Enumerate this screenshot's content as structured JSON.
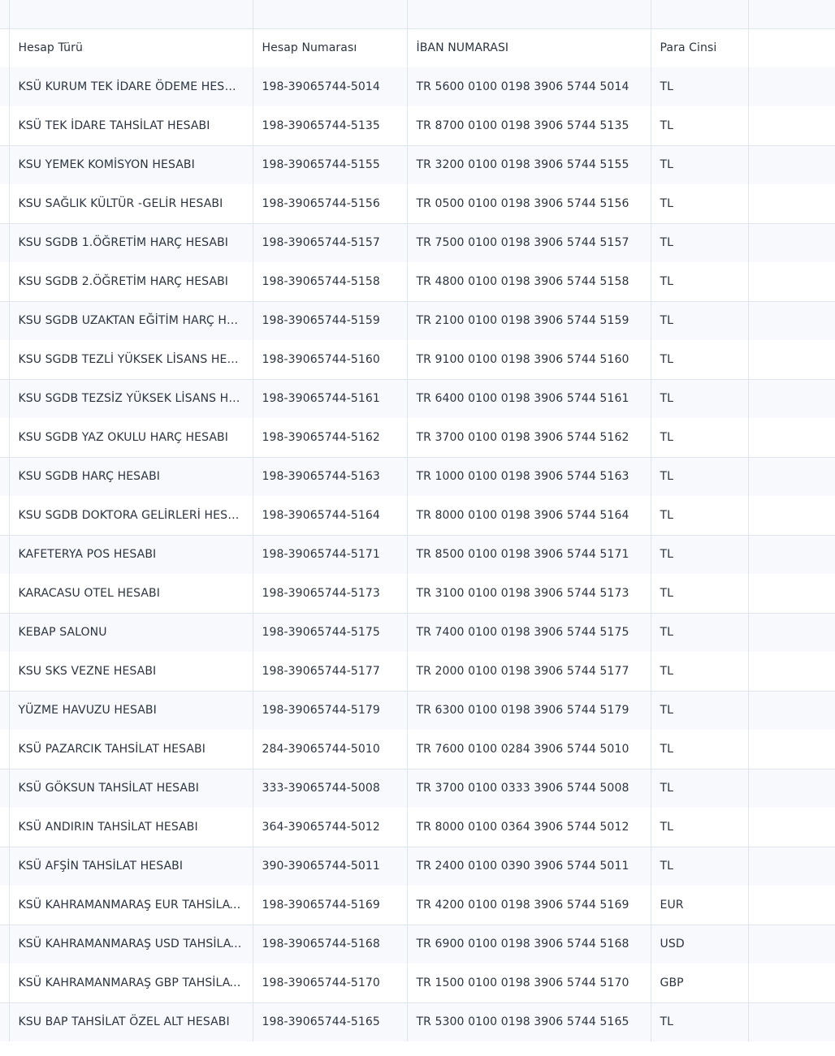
{
  "table": {
    "headers": {
      "type": "Hesap Türü",
      "number": "Hesap Numarası",
      "iban": "İBAN NUMARASI",
      "currency": "Para Cinsi"
    },
    "rows": [
      {
        "type": "KSÜ KURUM TEK İDARE ÖDEME HESABI",
        "number": "198-39065744-5014",
        "iban": "TR 5600 0100 0198 3906 5744 5014",
        "currency": "TL"
      },
      {
        "type": "KSÜ TEK İDARE TAHSİLAT HESABI",
        "number": "198-39065744-5135",
        "iban": "TR 8700 0100 0198 3906 5744 5135",
        "currency": "TL"
      },
      {
        "type": "KSU YEMEK KOMİSYON HESABI",
        "number": "198-39065744-5155",
        "iban": "TR 3200 0100 0198 3906 5744 5155",
        "currency": "TL"
      },
      {
        "type": "KSU SAĞLIK KÜLTÜR -GELİR HESABI",
        "number": "198-39065744-5156",
        "iban": "TR 0500 0100 0198 3906 5744 5156",
        "currency": "TL"
      },
      {
        "type": "KSU SGDB 1.ÖĞRETİM HARÇ HESABI",
        "number": "198-39065744-5157",
        "iban": "TR 7500 0100 0198 3906 5744 5157",
        "currency": "TL"
      },
      {
        "type": "KSU SGDB 2.ÖĞRETİM HARÇ HESABI",
        "number": "198-39065744-5158",
        "iban": "TR 4800 0100 0198 3906 5744 5158",
        "currency": "TL"
      },
      {
        "type": "KSU SGDB UZAKTAN EĞİTİM HARÇ HESABI",
        "number": "198-39065744-5159",
        "iban": "TR 2100 0100 0198 3906 5744 5159",
        "currency": "TL"
      },
      {
        "type": "KSU SGDB TEZLİ YÜKSEK LİSANS HESABI",
        "number": "198-39065744-5160",
        "iban": "TR 9100 0100 0198 3906 5744 5160",
        "currency": "TL"
      },
      {
        "type": "KSU SGDB TEZSİZ YÜKSEK LİSANS HESABI",
        "number": "198-39065744-5161",
        "iban": "TR 6400 0100 0198 3906 5744 5161",
        "currency": "TL"
      },
      {
        "type": "KSU SGDB YAZ OKULU HARÇ HESABI",
        "number": "198-39065744-5162",
        "iban": "TR 3700 0100 0198 3906 5744 5162",
        "currency": "TL"
      },
      {
        "type": "KSU SGDB  HARÇ HESABI",
        "number": "198-39065744-5163",
        "iban": "TR 1000 0100 0198 3906 5744 5163",
        "currency": "TL"
      },
      {
        "type": "KSU SGDB DOKTORA GELİRLERİ HESABI",
        "number": "198-39065744-5164",
        "iban": "TR 8000 0100 0198 3906 5744 5164",
        "currency": "TL"
      },
      {
        "type": "KAFETERYA POS HESABI",
        "number": "198-39065744-5171",
        "iban": "TR 8500 0100 0198 3906 5744 5171",
        "currency": "TL"
      },
      {
        "type": "KARACASU OTEL HESABI",
        "number": "198-39065744-5173",
        "iban": "TR 3100 0100 0198 3906 5744 5173",
        "currency": "TL"
      },
      {
        "type": "KEBAP SALONU",
        "number": "198-39065744-5175",
        "iban": "TR 7400 0100 0198 3906 5744 5175",
        "currency": "TL"
      },
      {
        "type": "KSU SKS VEZNE HESABI",
        "number": "198-39065744-5177",
        "iban": "TR 2000 0100 0198 3906 5744 5177",
        "currency": "TL"
      },
      {
        "type": "YÜZME HAVUZU HESABI",
        "number": "198-39065744-5179",
        "iban": "TR 6300 0100 0198 3906 5744 5179",
        "currency": "TL"
      },
      {
        "type": "KSÜ PAZARCIK TAHSİLAT HESABI",
        "number": "284-39065744-5010",
        "iban": "TR 7600 0100 0284 3906 5744 5010",
        "currency": "TL"
      },
      {
        "type": "KSÜ GÖKSUN TAHSİLAT HESABI",
        "number": "333-39065744-5008",
        "iban": "TR 3700 0100 0333 3906 5744 5008",
        "currency": "TL"
      },
      {
        "type": "KSÜ ANDIRIN TAHSİLAT HESABI",
        "number": "364-39065744-5012",
        "iban": "TR 8000 0100 0364 3906 5744 5012",
        "currency": "TL"
      },
      {
        "type": "KSÜ AFŞİN TAHSİLAT HESABI",
        "number": "390-39065744-5011",
        "iban": "TR 2400 0100 0390 3906 5744 5011",
        "currency": "TL"
      },
      {
        "type": "KSÜ KAHRAMANMARAŞ EUR TAHSİLAT HESABI",
        "number": "198-39065744-5169",
        "iban": "TR 4200 0100 0198 3906 5744 5169",
        "currency": "EUR"
      },
      {
        "type": "KSÜ KAHRAMANMARAŞ USD TAHSİLAT HESABI",
        "number": "198-39065744-5168",
        "iban": "TR 6900 0100 0198 3906 5744 5168",
        "currency": "USD"
      },
      {
        "type": "KSÜ KAHRAMANMARAŞ GBP TAHSİLAT HESABI",
        "number": "198-39065744-5170",
        "iban": "TR 1500 0100 0198 3906 5744 5170",
        "currency": "GBP"
      },
      {
        "type": "KSU BAP TAHSİLAT ÖZEL ALT HESABI",
        "number": "198-39065744-5165",
        "iban": "TR 5300 0100 0198 3906 5744 5165",
        "currency": "TL"
      }
    ]
  }
}
